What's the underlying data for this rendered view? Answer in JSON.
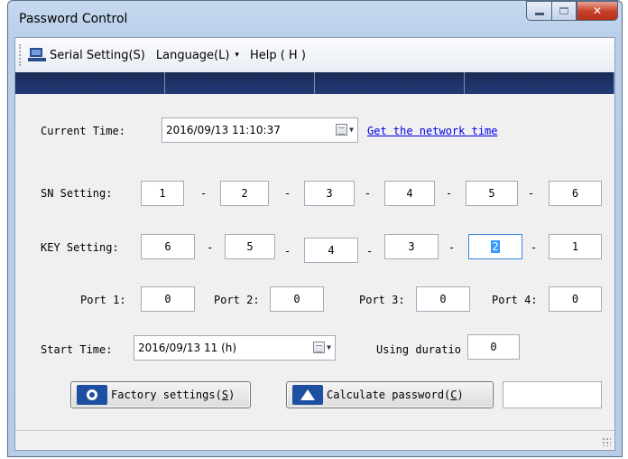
{
  "window": {
    "title": "Password Control"
  },
  "menu": {
    "serial": "Serial Setting(S)",
    "language": "Language(L)",
    "language_caret": "▾",
    "help": "Help ( H )"
  },
  "current_time": {
    "label": "Current Time:",
    "value": "2016/09/13   11:10:37",
    "network_link": "Get the network time"
  },
  "sn": {
    "label": "SN Setting:",
    "values": [
      "1",
      "2",
      "3",
      "4",
      "5",
      "6"
    ],
    "separator": "-"
  },
  "key": {
    "label": "KEY Setting:",
    "values": [
      "6",
      "5",
      "4",
      "3",
      "2",
      "1"
    ],
    "separator": "-"
  },
  "ports": [
    {
      "label": "Port 1:",
      "value": "0"
    },
    {
      "label": "Port 2:",
      "value": "0"
    },
    {
      "label": "Port 3:",
      "value": "0"
    },
    {
      "label": "Port 4:",
      "value": "0"
    }
  ],
  "start_time": {
    "label": "Start Time:",
    "value": "2016/09/13   11 (h)"
  },
  "using_duration": {
    "label": "Using duratio",
    "value": "0"
  },
  "buttons": {
    "factory_pre": "Factory settings(",
    "factory_key": "S",
    "factory_post": ")",
    "calc_pre": "Calculate password(",
    "calc_key": "C",
    "calc_post": ")"
  },
  "password_result": ""
}
